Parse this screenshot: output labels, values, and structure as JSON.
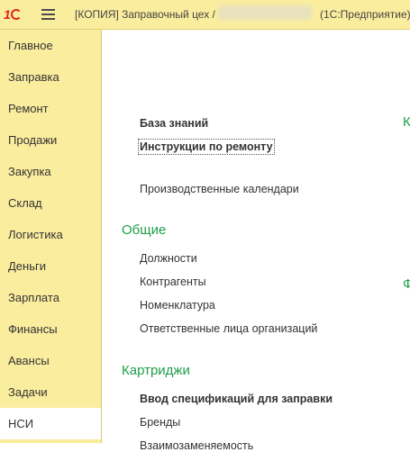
{
  "window": {
    "title": "[КОПИЯ] Заправочный цех /",
    "app_name": "(1С:Предприятие)"
  },
  "sidebar": {
    "items": [
      {
        "label": "Главное"
      },
      {
        "label": "Заправка"
      },
      {
        "label": "Ремонт"
      },
      {
        "label": "Продажи"
      },
      {
        "label": "Закупка"
      },
      {
        "label": "Склад"
      },
      {
        "label": "Логистика"
      },
      {
        "label": "Деньги"
      },
      {
        "label": "Зарплата"
      },
      {
        "label": "Финансы"
      },
      {
        "label": "Авансы"
      },
      {
        "label": "Задачи"
      },
      {
        "label": "НСИ"
      }
    ],
    "active": "НСИ"
  },
  "main": {
    "knowledge": {
      "title": "База знаний",
      "link": "Инструкции по ремонту"
    },
    "calendars": "Производственные календари",
    "general": {
      "heading": "Общие",
      "items": [
        "Должности",
        "Контрагенты",
        "Номенклатура",
        "Ответственные лица организаций"
      ]
    },
    "cartridges": {
      "heading": "Картриджи",
      "items": [
        "Ввод спецификаций для заправки",
        "Бренды",
        "Взаимозаменяемость"
      ]
    },
    "right_col_headings": [
      "К",
      "Ф"
    ]
  },
  "colors": {
    "panel": "#fbed9e",
    "heading": "#1f9e4a",
    "logo": "#d9271f"
  }
}
